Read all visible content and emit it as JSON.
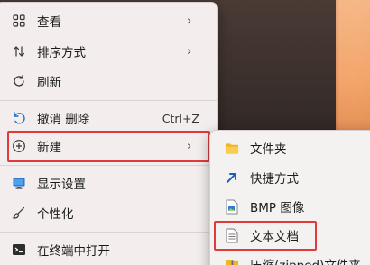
{
  "main_menu": {
    "items": [
      {
        "label": "查看",
        "icon": "grid-view-icon",
        "has_submenu": true
      },
      {
        "label": "排序方式",
        "icon": "sort-icon",
        "has_submenu": true
      },
      {
        "label": "刷新",
        "icon": "refresh-icon",
        "has_submenu": false
      },
      {
        "label": "撤消 删除",
        "icon": "undo-icon",
        "shortcut": "Ctrl+Z"
      },
      {
        "label": "新建",
        "icon": "new-plus-icon",
        "has_submenu": true
      },
      {
        "label": "显示设置",
        "icon": "display-icon"
      },
      {
        "label": "个性化",
        "icon": "brush-icon"
      },
      {
        "label": "在终端中打开",
        "icon": "terminal-icon"
      }
    ]
  },
  "sub_menu": {
    "items": [
      {
        "label": "文件夹",
        "icon": "folder-icon"
      },
      {
        "label": "快捷方式",
        "icon": "shortcut-arrow-icon"
      },
      {
        "label": "BMP 图像",
        "icon": "bmp-image-icon"
      },
      {
        "label": "文本文档",
        "icon": "text-document-icon"
      },
      {
        "label": "压缩(zipped)文件夹",
        "icon": "zip-folder-icon"
      }
    ]
  },
  "colors": {
    "highlight": "#e03b3b",
    "menu_bg": "#f3eded",
    "accent": "#1a73c8"
  }
}
